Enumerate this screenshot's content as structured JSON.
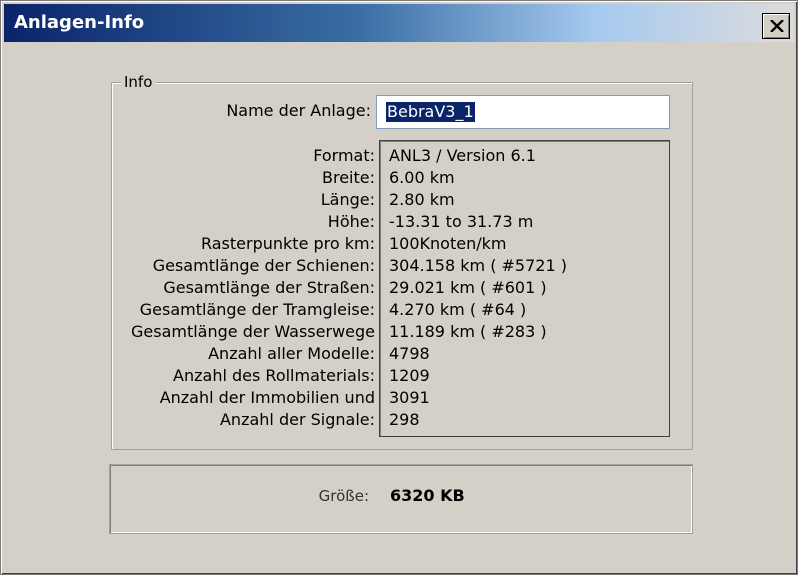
{
  "window": {
    "title": "Anlagen-Info",
    "close_symbol": "close-icon"
  },
  "info_group": {
    "legend": "Info",
    "name_label": "Name der Anlage:",
    "name_value": "BebraV3_1",
    "rows": [
      {
        "label": "Format:",
        "value": "ANL3 / Version 6.1"
      },
      {
        "label": "Breite:",
        "value": "6.00 km"
      },
      {
        "label": "Länge:",
        "value": "2.80 km"
      },
      {
        "label": "Höhe:",
        "value": "-13.31 to 31.73 m"
      },
      {
        "label": "Rasterpunkte pro km:",
        "value": "100Knoten/km"
      },
      {
        "label": "Gesamtlänge der Schienen:",
        "value": "304.158 km ( #5721 )"
      },
      {
        "label": "Gesamtlänge der Straßen:",
        "value": "29.021 km ( #601 )"
      },
      {
        "label": "Gesamtlänge der Tramgleise:",
        "value": "4.270 km ( #64 )"
      },
      {
        "label": "Gesamtlänge der Wasserwege",
        "value": "11.189 km ( #283 )"
      },
      {
        "label": "Anzahl aller Modelle:",
        "value": "4798"
      },
      {
        "label": "Anzahl des Rollmaterials:",
        "value": "1209"
      },
      {
        "label": "Anzahl der Immobilien und",
        "value": "3091"
      },
      {
        "label": "Anzahl der Signale:",
        "value": "298"
      }
    ]
  },
  "size_panel": {
    "label": "Größe:",
    "value": "6320 KB"
  },
  "colors": {
    "titlebar_start": "#0a246a",
    "titlebar_end": "#dcdcdc",
    "dialog_bg": "#d4d0c8",
    "selection": "#0a246a"
  }
}
